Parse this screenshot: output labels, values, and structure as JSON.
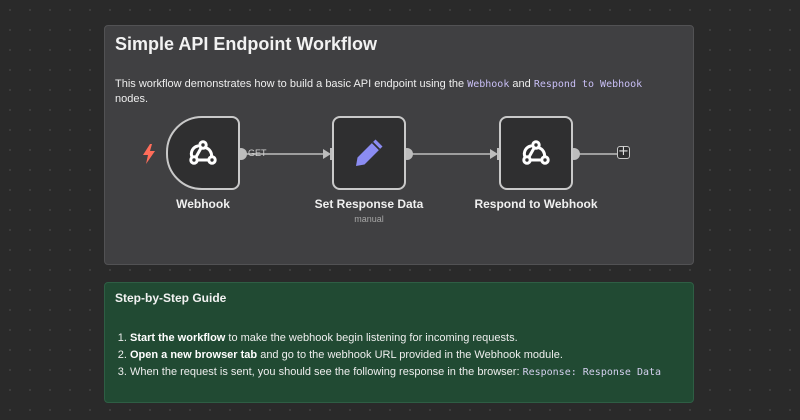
{
  "workflow_note": {
    "title": "Simple API Endpoint Workflow",
    "description_prefix": "This workflow demonstrates how to build a basic API endpoint using the ",
    "code_webhook": "Webhook",
    "description_and": " and ",
    "code_respond": "Respond to Webhook",
    "description_suffix": " nodes."
  },
  "nodes": [
    {
      "label": "Webhook",
      "icon": "webhook-icon",
      "type": "trigger"
    },
    {
      "label": "Set Response Data",
      "subtitle": "manual",
      "icon": "pencil-icon"
    },
    {
      "label": "Respond to Webhook",
      "icon": "webhook-icon"
    }
  ],
  "connection_label": "GET",
  "add_node_symbol": "+",
  "guide": {
    "title": "Step-by-Step Guide",
    "steps": [
      {
        "bold": "Start the workflow",
        "text": " to make the webhook begin listening for incoming requests."
      },
      {
        "bold": "Open a new browser tab",
        "text": " and go to the webhook URL provided in the Webhook module."
      },
      {
        "text": "When the request is sent, you should see the following response in the browser: ",
        "code": "Response: Response Data"
      }
    ]
  },
  "colors": {
    "canvas_background": "#2a2a2a",
    "note_background": "#404042",
    "guide_background": "#214a33",
    "trigger_bolt": "#ff6d5a",
    "pencil_icon": "#8b8cf2",
    "code_text": "#c9bff6"
  }
}
